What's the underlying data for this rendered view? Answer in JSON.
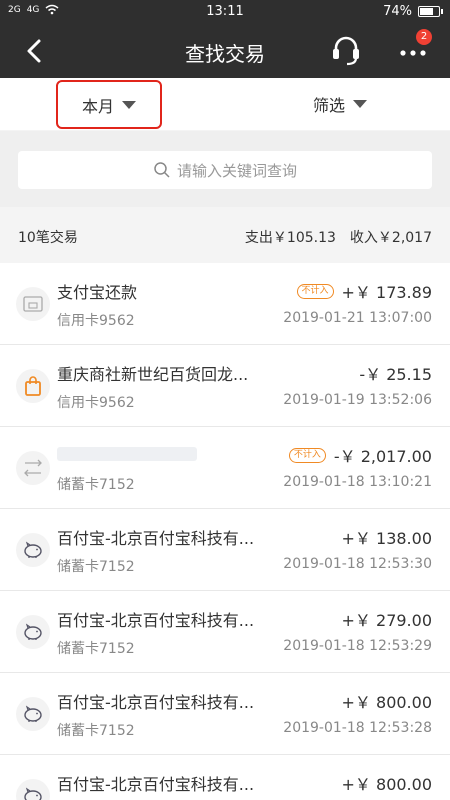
{
  "status_bar": {
    "signal_left": "2G",
    "signal_right": "4G",
    "time": "13:11",
    "battery_percent": "74%",
    "battery_level": 0.74
  },
  "header": {
    "title": "查找交易",
    "badge": "2"
  },
  "filters": {
    "month_label": "本月",
    "filter_label": "筛选"
  },
  "search": {
    "placeholder": "请输入关键词查询"
  },
  "summary": {
    "count": "10笔交易",
    "expense": "支出￥105.13",
    "income": "收入￥2,017"
  },
  "transactions": [
    {
      "name": "支付宝还款",
      "account": "信用卡9562",
      "tag": "不计入",
      "amount": "+￥ 173.89",
      "date": "2019-01-21 13:07:00",
      "icon": "card-icon"
    },
    {
      "name": "重庆商社新世纪百货回龙...",
      "account": "信用卡9562",
      "tag": "",
      "amount": "-￥ 25.15",
      "date": "2019-01-19 13:52:06",
      "icon": "shopping-bag-icon"
    },
    {
      "name": "",
      "account": "储蓄卡7152",
      "tag": "不计入",
      "amount": "-￥ 2,017.00",
      "date": "2019-01-18 13:10:21",
      "icon": "transfer-icon"
    },
    {
      "name": "百付宝-北京百付宝科技有...",
      "account": "储蓄卡7152",
      "tag": "",
      "amount": "+￥ 138.00",
      "date": "2019-01-18 12:53:30",
      "icon": "piggy-bank-icon"
    },
    {
      "name": "百付宝-北京百付宝科技有...",
      "account": "储蓄卡7152",
      "tag": "",
      "amount": "+￥ 279.00",
      "date": "2019-01-18 12:53:29",
      "icon": "piggy-bank-icon"
    },
    {
      "name": "百付宝-北京百付宝科技有...",
      "account": "储蓄卡7152",
      "tag": "",
      "amount": "+￥ 800.00",
      "date": "2019-01-18 12:53:28",
      "icon": "piggy-bank-icon"
    },
    {
      "name": "百付宝-北京百付宝科技有...",
      "account": "",
      "tag": "",
      "amount": "+￥ 800.00",
      "date": "",
      "icon": "piggy-bank-icon"
    }
  ],
  "colors": {
    "header_bg": "#2f2f2f",
    "highlight_border": "#e1251b",
    "tag_orange": "#f08a24",
    "badge_red": "#f04134"
  }
}
